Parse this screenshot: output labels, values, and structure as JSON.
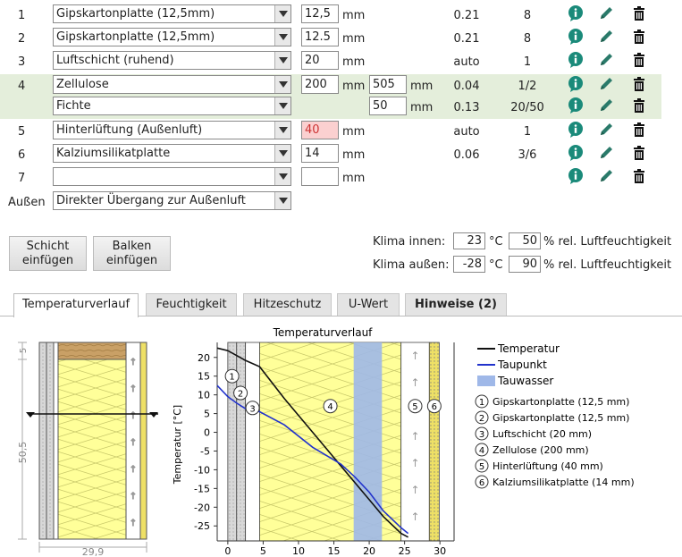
{
  "layers": [
    {
      "num": "1",
      "material": "Gipskartonplatte (12,5mm)",
      "thickness": "12,5",
      "unit": "mm",
      "lambda": "0.21",
      "mu": "8"
    },
    {
      "num": "2",
      "material": "Gipskartonplatte (12,5mm)",
      "thickness": "12.5",
      "unit": "mm",
      "lambda": "0.21",
      "mu": "8"
    },
    {
      "num": "3",
      "material": "Luftschicht (ruhend)",
      "thickness": "20",
      "unit": "mm",
      "lambda": "auto",
      "mu": "1"
    },
    {
      "num": "4",
      "material": "Zellulose",
      "thickness": "200",
      "unit": "mm",
      "width": "505",
      "width_unit": "mm",
      "lambda": "0.04",
      "mu": "1/2"
    },
    {
      "num": "",
      "material": "Fichte",
      "thickness": "",
      "unit": "",
      "width": "50",
      "width_unit": "mm",
      "lambda": "0.13",
      "mu": "20/50"
    },
    {
      "num": "5",
      "material": "Hinterlüftung (Außenluft)",
      "thickness": "40",
      "unit": "mm",
      "lambda": "auto",
      "mu": "1"
    },
    {
      "num": "6",
      "material": "Kalziumsilikatplatte",
      "thickness": "14",
      "unit": "mm",
      "lambda": "0.06",
      "mu": "3/6"
    },
    {
      "num": "7",
      "material": "",
      "thickness": "",
      "unit": "mm",
      "lambda": "",
      "mu": ""
    }
  ],
  "outside": {
    "label": "Außen",
    "value": "Direkter Übergang zur Außenluft"
  },
  "buttons": {
    "add_layer_1": "Schicht",
    "add_layer_2": "einfügen",
    "add_beam_1": "Balken",
    "add_beam_2": "einfügen"
  },
  "klima": {
    "inside_label": "Klima innen:",
    "inside_temp": "23",
    "inside_rh": "50",
    "outside_label": "Klima außen:",
    "outside_temp": "-28",
    "outside_rh": "90",
    "temp_unit": "°C",
    "rh_unit": "% rel. Luftfeuchtigkeit"
  },
  "tabs": [
    "Temperaturverlauf",
    "Feuchtigkeit",
    "Hitzeschutz",
    "U-Wert",
    "Hinweise (2)"
  ],
  "section": {
    "dim_top": "5",
    "dim_mid": "50,5",
    "dim_bottom": "29,9"
  },
  "chart_data": {
    "type": "line",
    "title": "Temperaturverlauf",
    "ylabel": "Temperatur [°C]",
    "xlabel": "",
    "xlim": [
      -1.5,
      32
    ],
    "ylim": [
      -29,
      24
    ],
    "xticks": [
      0,
      5,
      10,
      15,
      20,
      25,
      30
    ],
    "yticks": [
      20,
      15,
      10,
      5,
      0,
      -5,
      -10,
      -15,
      -20,
      -25
    ],
    "series": [
      {
        "name": "Temperatur",
        "color": "#111111",
        "x": [
          -1.5,
          0,
          1.25,
          2.5,
          4.5,
          8,
          12,
          16,
          20,
          22,
          24.5,
          25.5
        ],
        "y": [
          22.5,
          21.8,
          20.5,
          19.2,
          17.5,
          9,
          0,
          -9,
          -18,
          -22.5,
          -27,
          -28
        ]
      },
      {
        "name": "Taupunkt",
        "color": "#2233cc",
        "x": [
          -1.5,
          0,
          1.25,
          2.5,
          4.5,
          8,
          12,
          16,
          18,
          20,
          22,
          24.5,
          25.5
        ],
        "y": [
          12.5,
          9.5,
          7.8,
          6.3,
          5.5,
          2,
          -4,
          -8.5,
          -12,
          -16,
          -21,
          -25.5,
          -27
        ]
      }
    ],
    "condensate": {
      "name": "Tauwasser",
      "x_range": [
        17.8,
        21.8
      ],
      "color": "#9fb8e8"
    },
    "layers": [
      {
        "id": "1",
        "label": "Gipskartonplatte (12,5 mm)",
        "x_range": [
          0,
          1.25
        ]
      },
      {
        "id": "2",
        "label": "Gipskartonplatte (12,5 mm)",
        "x_range": [
          1.25,
          2.5
        ]
      },
      {
        "id": "3",
        "label": "Luftschicht (20 mm)",
        "x_range": [
          2.5,
          4.5
        ]
      },
      {
        "id": "4",
        "label": "Zellulose (200 mm)",
        "x_range": [
          4.5,
          24.5
        ]
      },
      {
        "id": "5",
        "label": "Hinterlüftung (40 mm)",
        "x_range": [
          24.5,
          28.5
        ]
      },
      {
        "id": "6",
        "label": "Kalziumsilikatplatte (14 mm)",
        "x_range": [
          28.5,
          29.9
        ]
      }
    ]
  }
}
